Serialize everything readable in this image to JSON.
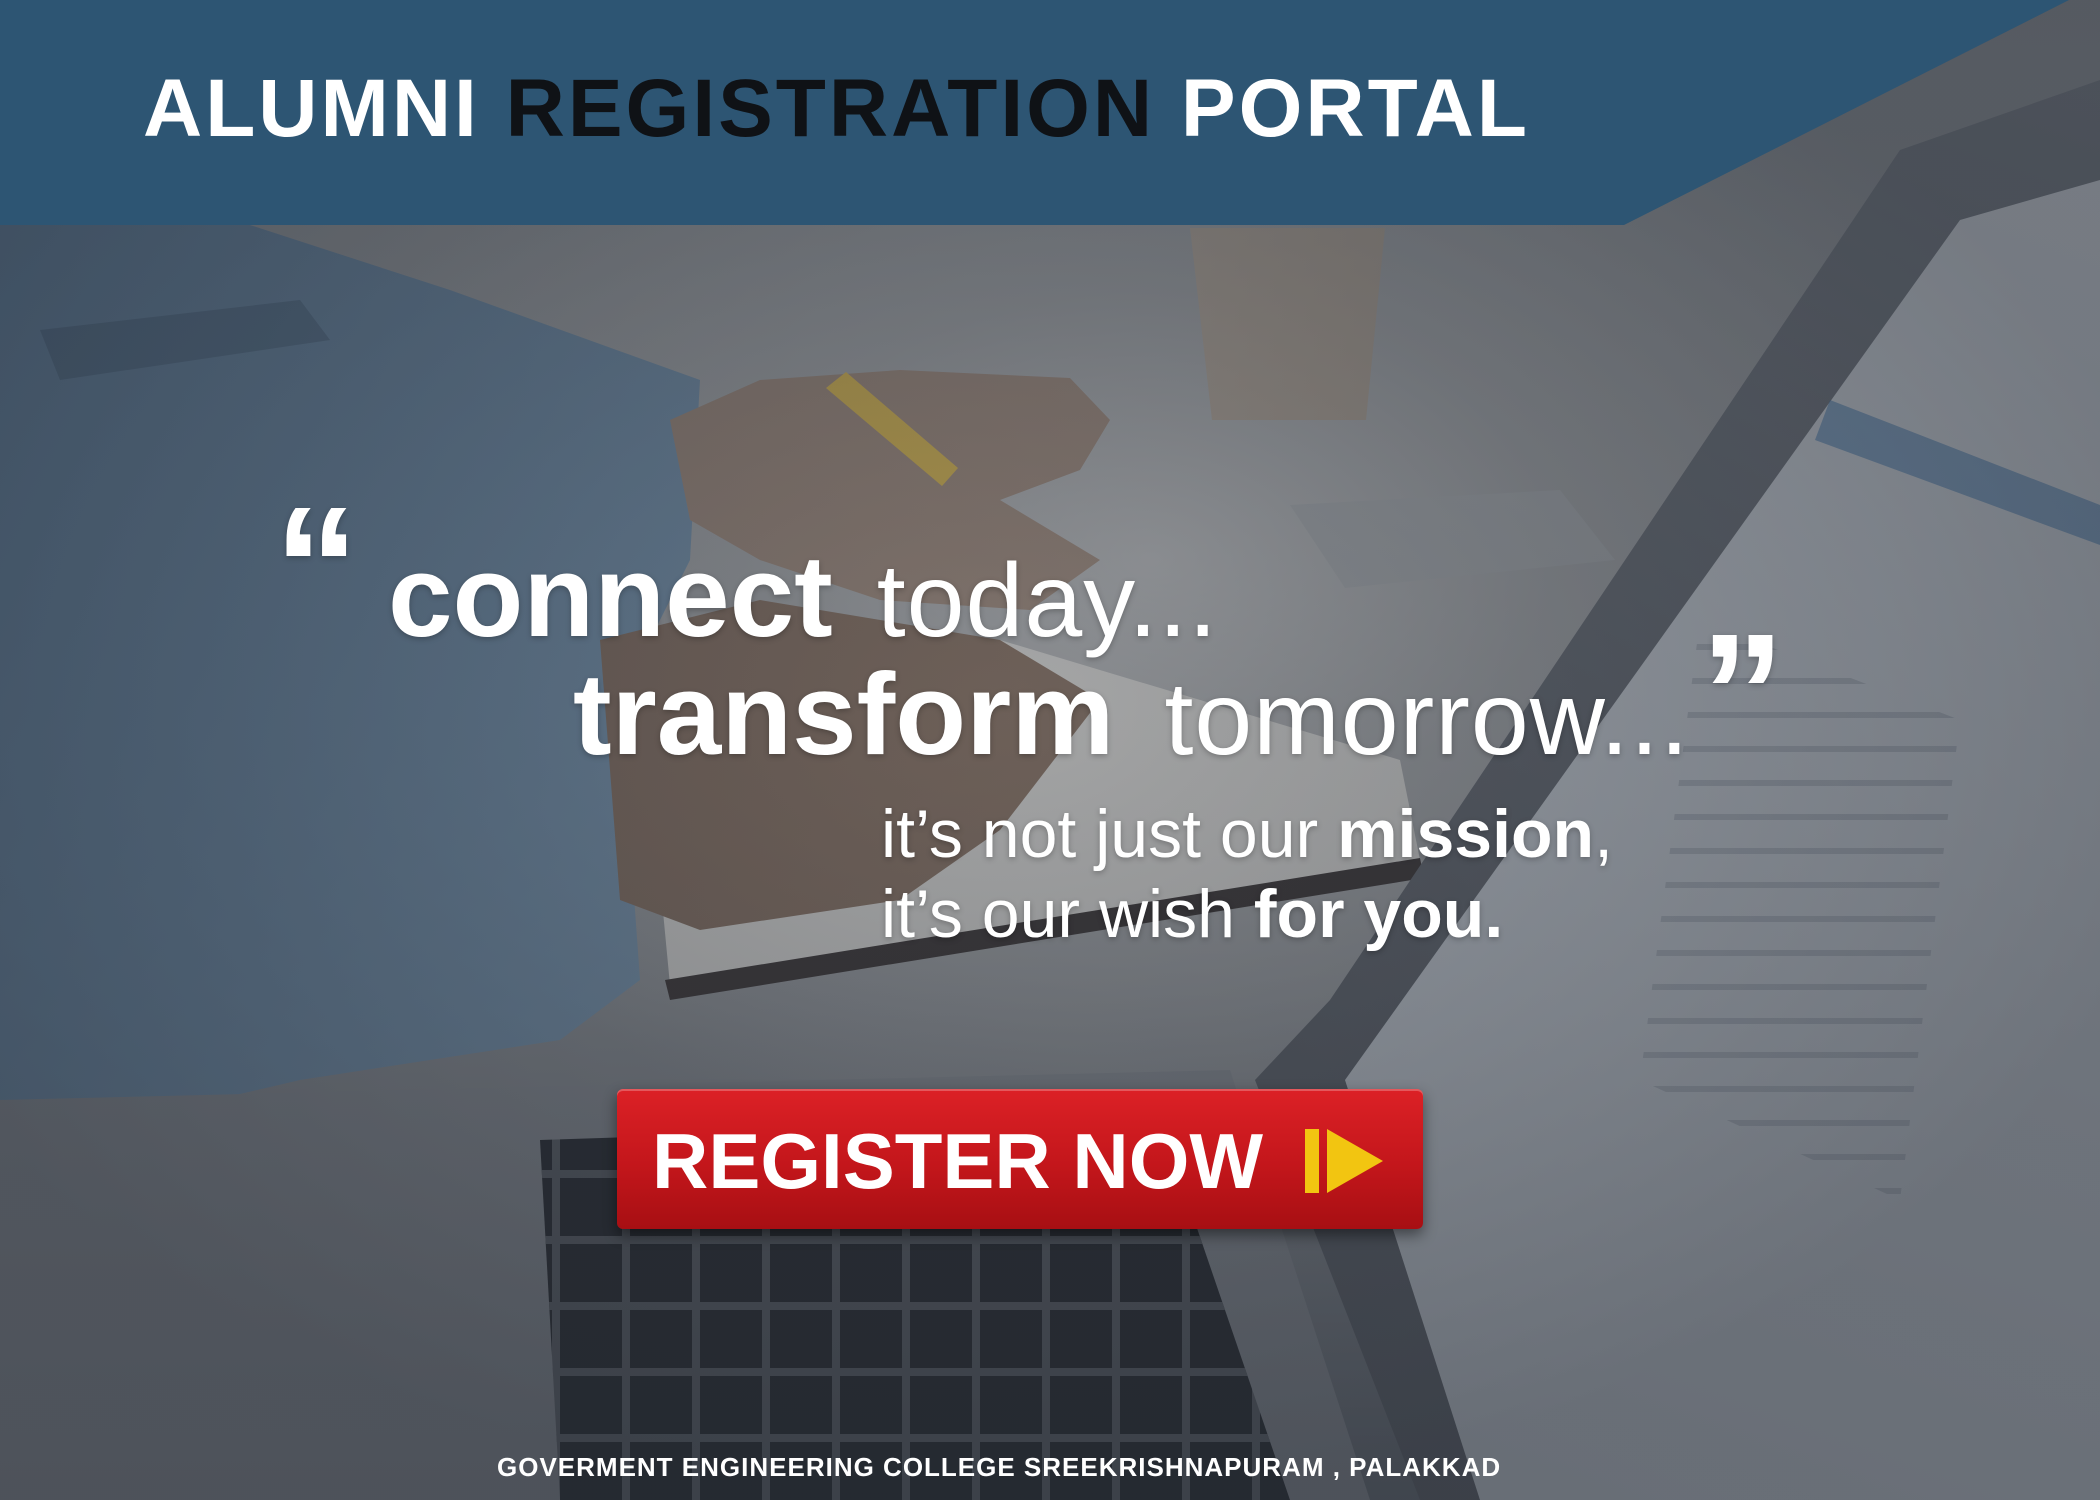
{
  "header": {
    "title_part1": "ALUMNI",
    "title_part2": "REGISTRATION",
    "title_part3": "PORTAL"
  },
  "tagline": {
    "open_quote": "“",
    "line1_bold": "connect",
    "line1_light": "today...",
    "line2_bold": "transform",
    "line2_light": "tomorrow...",
    "close_quote": "”",
    "line3_prefix": "it’s not just our",
    "line3_bold": "mission",
    "line3_suffix": ",",
    "line4_prefix": "it’s our wish",
    "line4_bold": "for you."
  },
  "cta": {
    "label": "REGISTER NOW",
    "icon": "play-icon"
  },
  "footer": {
    "text": "GOVERMENT ENGINEERING COLLEGE SREEKRISHNAPURAM , PALAKKAD"
  },
  "colors": {
    "banner": "#2d5573",
    "title_accent": "#0f1216",
    "button": "#c3161b",
    "play_icon": "#f2c511",
    "text": "#ffffff"
  }
}
